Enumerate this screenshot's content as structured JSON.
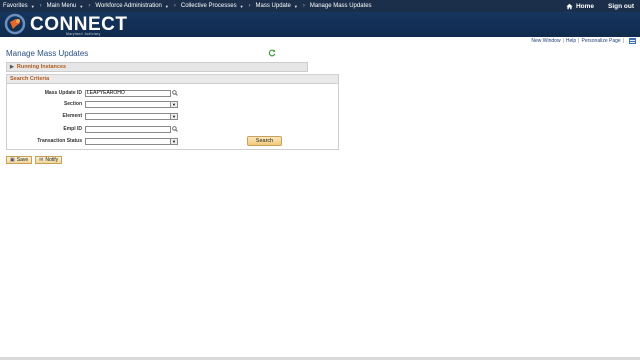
{
  "menubar": {
    "items": [
      {
        "label": "Favorites"
      },
      {
        "label": "Main Menu"
      },
      {
        "label": "Workforce Administration"
      },
      {
        "label": "Collective Processes"
      },
      {
        "label": "Mass Update"
      },
      {
        "label": "Manage Mass Updates"
      }
    ],
    "home_label": "Home",
    "signout_label": "Sign out"
  },
  "banner": {
    "logo_text": "CONNECT",
    "logo_sub": "Maryland Judiciary"
  },
  "toplinks": {
    "new_window": "New Window",
    "help": "Help",
    "personalize": "Personalize Page",
    "sep": "|"
  },
  "page": {
    "title": "Manage Mass Updates",
    "running_instances": "Running Instances",
    "criteria_title": "Search Criteria"
  },
  "form": {
    "mass_update_id_label": "Mass Update ID",
    "mass_update_id_value": "LEAPYEAROHO",
    "section_label": "Section",
    "element_label": "Element",
    "empl_id_label": "Empl ID",
    "transaction_status_label": "Transaction Status",
    "search_button": "Search"
  },
  "buttons": {
    "save": "Save",
    "notify": "Notify"
  },
  "icons": {
    "home": "home-icon",
    "refresh": "refresh-icon",
    "lookup": "magnifier-icon",
    "grid": "grid-icon"
  }
}
